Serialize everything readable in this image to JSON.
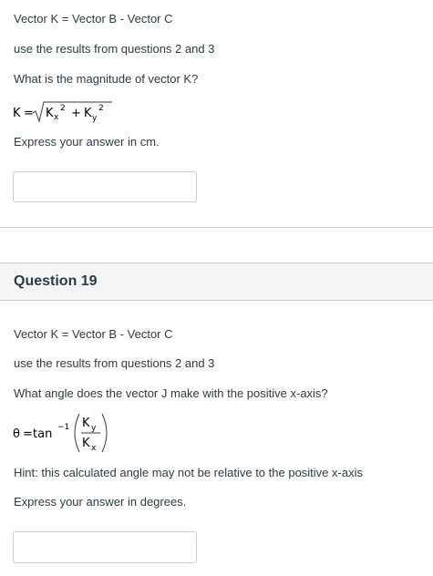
{
  "question18": {
    "line1": "Vector K = Vector B - Vector C",
    "line2": "use the results from questions 2 and 3",
    "prompt": "What is the magnitude of vector K?",
    "formula": {
      "lhs": "K",
      "equals": "=",
      "k": "K",
      "x": "x",
      "y": "y",
      "two": "2",
      "plus": "+"
    },
    "instruction": "Express your answer in cm.",
    "answer_value": ""
  },
  "question19": {
    "title": "Question 19",
    "line1": "Vector K = Vector B - Vector C",
    "line2": "use the results from questions 2 and 3",
    "prompt": "What angle does the vector J make with the positive x-axis?",
    "formula": {
      "theta": "θ",
      "equals": "=",
      "tan": "tan",
      "neg1": "−1",
      "k": "K",
      "x": "x",
      "y": "y"
    },
    "hint": "Hint: this calculated angle may not be relative to the positive x-axis",
    "instruction": "Express your answer in degrees.",
    "answer_value": ""
  }
}
